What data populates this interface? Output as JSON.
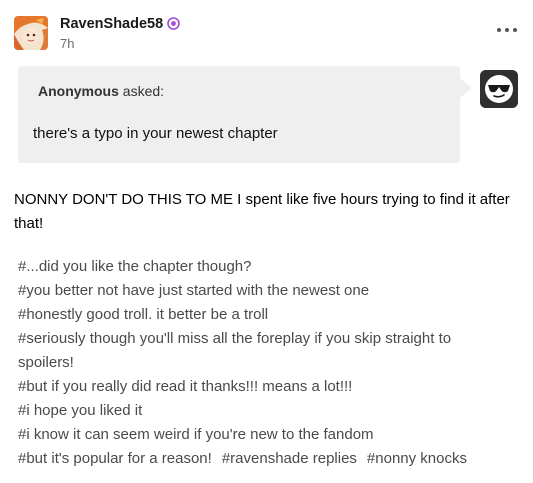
{
  "post": {
    "username": "RavenShade58",
    "time": "7h",
    "badge_icon": "pronoun-badge-icon",
    "more_icon": "ellipsis-icon"
  },
  "ask": {
    "asker": "Anonymous",
    "asked_label": "asked:",
    "question": "there's a typo in your newest chapter",
    "anon_avatar_icon": "sunglasses-anon-icon"
  },
  "answer": {
    "text": "NONNY DON'T DO THIS TO ME I spent like five hours trying to find it after that!"
  },
  "tags": [
    "#...did you like the chapter though?",
    "#you better not have just started with the newest one",
    "#honestly good troll. it better be a troll",
    "#seriously though you'll miss all the foreplay if you skip straight to spoilers!",
    "#but if you really did read it thanks!!! means a lot!!!",
    "#i hope you liked it",
    "#i know it can seem weird if you're new to the fandom",
    "#but it's popular for a reason!",
    "#ravenshade replies",
    "#nonny knocks"
  ],
  "colors": {
    "ask_background": "#efefef",
    "tag_text": "#4a4a4a",
    "badge": "#a24bd6"
  }
}
